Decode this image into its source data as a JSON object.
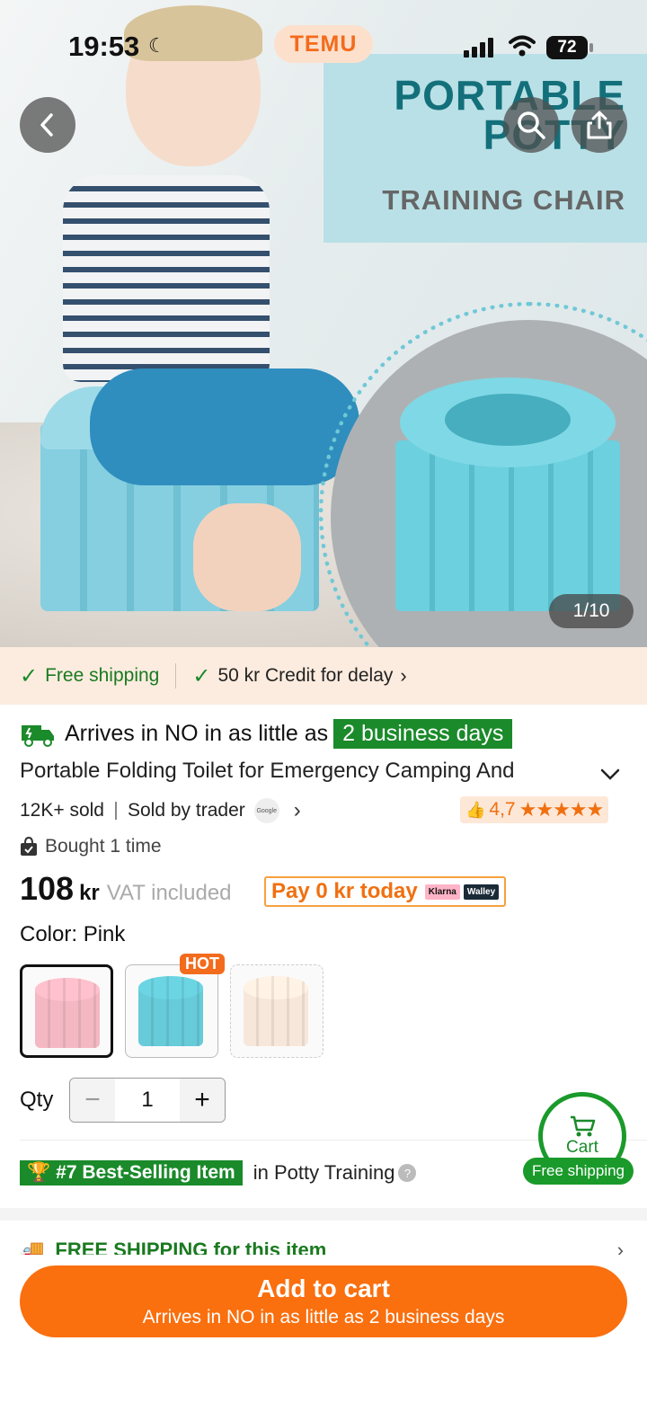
{
  "status_bar": {
    "time": "19:53",
    "battery": "72"
  },
  "app": {
    "brand": "TEMU"
  },
  "hero": {
    "banner_line1": "PORTABLE POTTY",
    "banner_line2": "TRAINING CHAIR",
    "image_counter": "1/10"
  },
  "strip": {
    "free_shipping": "Free shipping",
    "credit": "50 kr Credit for delay"
  },
  "product": {
    "arrives_prefix": "Arrives in NO in as little as",
    "arrives_days": "2 business days",
    "title": "Portable Folding Toilet for Emergency Camping And",
    "sold": "12K+ sold",
    "seller": "Sold by trader",
    "seller_badge": "Google",
    "rating": "4,7",
    "stars": "★★★★★",
    "bought": "Bought 1 time",
    "price_value": "108",
    "price_currency": "kr",
    "vat": "VAT included",
    "pay_today": "Pay 0 kr today",
    "klarna": "Klarna",
    "walley": "Walley",
    "color_label": "Color: Pink",
    "hot_badge": "HOT",
    "qty_label": "Qty",
    "qty_value": "1",
    "best_tag": "#7 Best-Selling Item",
    "best_suffix": "in Potty Training",
    "free_shipping_section": "FREE SHIPPING for this item"
  },
  "cart": {
    "label": "Cart",
    "pill": "Free shipping"
  },
  "footer": {
    "add_label": "Add to cart",
    "add_sub": "Arrives in NO in as little as 2 business days"
  },
  "colors": {
    "accent": "#fa6f0e",
    "green": "#1a8a2a",
    "teal": "#13707a"
  },
  "swatches": [
    {
      "name": "Pink",
      "color": "#f4b8c3",
      "selected": true
    },
    {
      "name": "Blue",
      "color": "#67cbd9",
      "selected": false
    },
    {
      "name": "Beige",
      "color": "#f7e7db",
      "selected": false
    }
  ]
}
